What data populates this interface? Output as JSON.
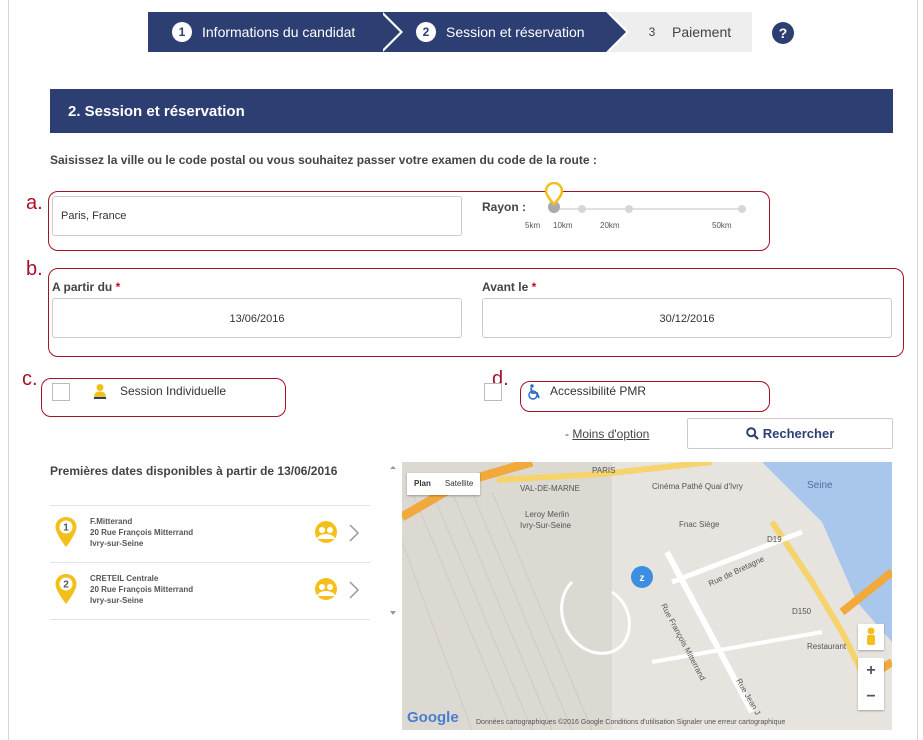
{
  "stepper": {
    "steps": [
      {
        "num": "1",
        "label": "Informations du candidat"
      },
      {
        "num": "2",
        "label": "Session et réservation"
      },
      {
        "num": "3",
        "label": "Paiement"
      }
    ],
    "help": "?"
  },
  "section": {
    "title": "2. Session et réservation",
    "instruction": "Saisissez la ville ou le code postal ou vous souhaitez passer votre examen du code de la route :"
  },
  "annotations": {
    "a": "a.",
    "b": "b.",
    "c": "c.",
    "d": "d."
  },
  "location": {
    "value": "Paris, France",
    "rayon_label": "Rayon :",
    "ticks": [
      "5km",
      "10km",
      "20km",
      "50km"
    ],
    "selected": "5km"
  },
  "dates": {
    "from_label": "A partir du",
    "before_label": "Avant le",
    "required": "*",
    "from_value": "13/06/2016",
    "before_value": "30/12/2016"
  },
  "options": {
    "individual_label": "Session Individuelle",
    "pmr_label": "Accessibilité PMR",
    "less_dash": "- ",
    "less_link": "Moins d'option",
    "search_label": "Rechercher"
  },
  "results": {
    "title": "Premières dates disponibles à partir de 13/06/2016",
    "items": [
      {
        "num": "1",
        "name": "F.Mitterand",
        "address": "20 Rue François Mitterrand",
        "city": "Ivry-sur-Seine"
      },
      {
        "num": "2",
        "name": "CRETEIL Centrale",
        "address": "20 Rue François Mitterrand",
        "city": "Ivry-sur-Seine"
      }
    ]
  },
  "map": {
    "tabs": [
      "Plan",
      "Satellite"
    ],
    "labels": {
      "cinema": "Cinéma Pathé Quai d'Ivry",
      "leroy": "Leroy Merlin",
      "leroy2": "Ivry-Sur-Seine",
      "fnac": "Fnac Siège",
      "seine": "Seine",
      "rue_fm": "Rue François Mitterrand",
      "rue_bretagne": "Rue de Bretagne",
      "restaurant": "Restaurant",
      "d19": "D19",
      "d150": "D150",
      "val": "VAL-DE-MARNE",
      "paris": "PARIS",
      "rue_jean": "Rue Jean J"
    },
    "zoom_in": "+",
    "zoom_out": "−",
    "google": "Google",
    "footer": "Données cartographiques ©2016 Google    Conditions d'utilisation    Signaler une erreur cartographique"
  },
  "colors": {
    "primary": "#2d3e73",
    "annotation": "#a8102a",
    "marker": "#f3c01b",
    "required": "#d0021b"
  }
}
